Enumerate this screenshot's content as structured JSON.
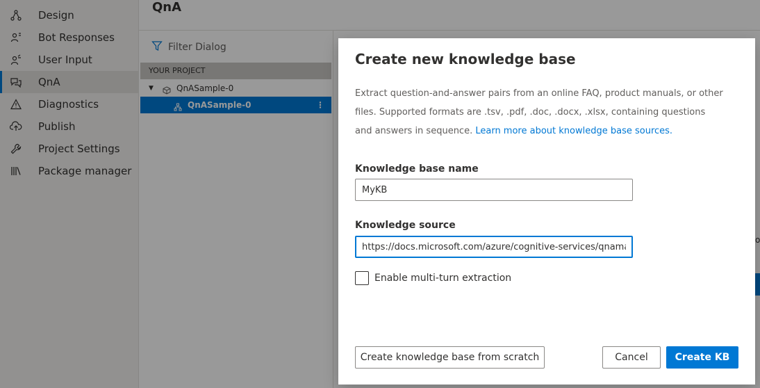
{
  "nav": {
    "items": [
      {
        "label": "Design",
        "icon": "design-icon"
      },
      {
        "label": "Bot Responses",
        "icon": "bot-responses-icon"
      },
      {
        "label": "User Input",
        "icon": "user-input-icon"
      },
      {
        "label": "QnA",
        "icon": "qna-icon",
        "active": true
      },
      {
        "label": "Diagnostics",
        "icon": "warning-icon"
      },
      {
        "label": "Publish",
        "icon": "cloud-upload-icon"
      },
      {
        "label": "Project Settings",
        "icon": "wrench-icon"
      },
      {
        "label": "Package manager",
        "icon": "library-icon"
      }
    ]
  },
  "page": {
    "title": "QnA"
  },
  "tree": {
    "filter_label": "Filter Dialog",
    "section_header": "YOUR PROJECT",
    "project": "QnASample-0",
    "dialog": "QnASample-0"
  },
  "modal": {
    "title": "Create new knowledge base",
    "description": "Extract question-and-answer pairs from an online FAQ, product manuals, or other files. Supported formats are .tsv, .pdf, .doc, .docx, .xlsx, containing questions and answers in sequence. ",
    "link_text": "Learn more about knowledge base sources.",
    "kb_name_label": "Knowledge base name",
    "kb_name_value": "MyKB",
    "kb_source_label": "Knowledge source",
    "kb_source_value": "https://docs.microsoft.com/azure/cognitive-services/qnamaker/faq",
    "multiturn_label": "Enable multi-turn extraction",
    "btn_scratch": "Create knowledge base from scratch",
    "btn_cancel": "Cancel",
    "btn_create": "Create KB"
  },
  "colors": {
    "accent": "#0078d4",
    "overlay": "rgba(0,0,0,0.4)"
  }
}
